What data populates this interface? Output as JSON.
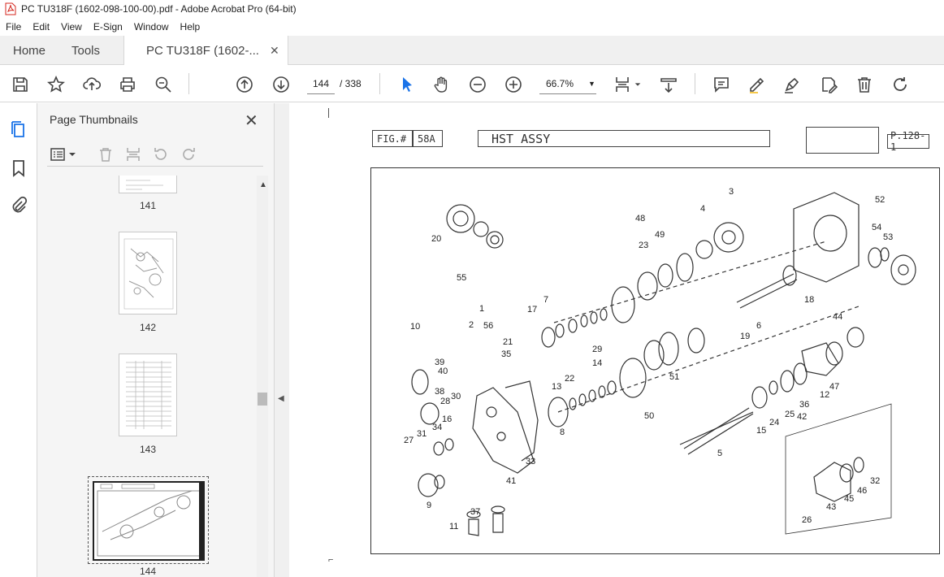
{
  "window": {
    "title": "PC TU318F (1602-098-100-00).pdf - Adobe Acrobat Pro (64-bit)"
  },
  "menu": [
    "File",
    "Edit",
    "View",
    "E-Sign",
    "Window",
    "Help"
  ],
  "tabs": {
    "home": "Home",
    "tools": "Tools",
    "doc": "PC TU318F (1602-..."
  },
  "toolbar": {
    "page_current": "144",
    "page_total": "/ 338",
    "zoom": "66.7%"
  },
  "panel": {
    "title": "Page Thumbnails"
  },
  "thumbnails": [
    "141",
    "142",
    "143",
    "144"
  ],
  "document": {
    "fig_label": "FIG.#",
    "fig_number": "58A",
    "title": "HST ASSY",
    "page_ref": "P.128-1",
    "callouts": [
      "1",
      "2",
      "56",
      "3",
      "4",
      "5",
      "6",
      "7",
      "8",
      "9",
      "10",
      "11",
      "12",
      "13",
      "14",
      "15",
      "16",
      "17",
      "18",
      "19",
      "20",
      "21",
      "22",
      "23",
      "24",
      "25",
      "26",
      "27",
      "28",
      "29",
      "30",
      "31",
      "32",
      "33",
      "34",
      "35",
      "36",
      "37",
      "38",
      "39",
      "40",
      "41",
      "42",
      "43",
      "44",
      "45",
      "46",
      "47",
      "48",
      "49",
      "50",
      "51",
      "52",
      "53",
      "54",
      "55"
    ]
  },
  "colors": {
    "accent": "#1a73e8",
    "pdf_red": "#d4251c"
  }
}
